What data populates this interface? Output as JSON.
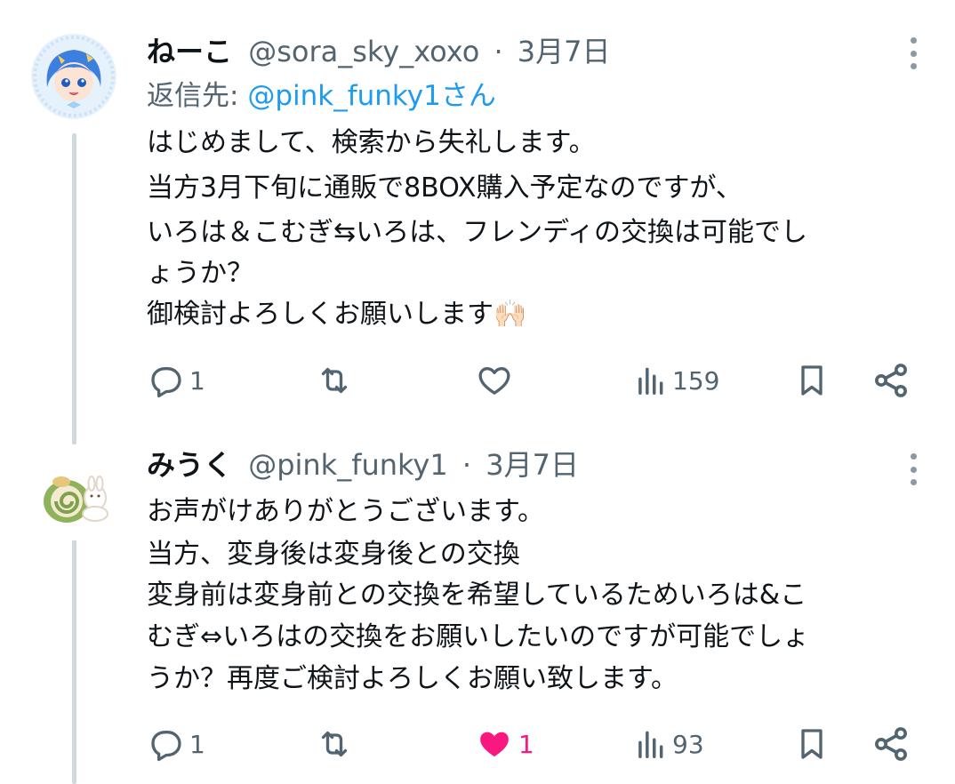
{
  "tweets": [
    {
      "name": "ねーこ",
      "handle": "@sora_sky_xoxo",
      "separator": "·",
      "date": "3月7日",
      "reply_to_prefix": "返信先: ",
      "reply_to_mention": "@pink_funky1さん",
      "lines": [
        "はじめまして、検索から失礼します。",
        "当方3月下旬に通販で8BOX購入予定なのですが、",
        "いろは＆こむぎ⇆いろは、フレンディの交換は可能でし",
        "ょうか？",
        "御検討よろしくお願いします🙌🏻"
      ],
      "actions": {
        "reply_count": "1",
        "retweet_count": "",
        "like_count": "",
        "views_count": "159"
      },
      "liked": false
    },
    {
      "name": "みうく",
      "handle": "@pink_funky1",
      "separator": "·",
      "date": "3月7日",
      "lines": [
        "お声がけありがとうございます。",
        "当方、変身後は変身後との交換",
        "変身前は変身前との交換を希望しているためいろは&こ",
        "むぎ⇔いろはの交換をお願いしたいのですが可能でしょ",
        "うか？再度ご検討よろしくお願い致します。"
      ],
      "actions": {
        "reply_count": "1",
        "retweet_count": "",
        "like_count": "1",
        "views_count": "93"
      },
      "liked": true
    }
  ],
  "colors": {
    "text": "#0f1419",
    "muted": "#536471",
    "link": "#1d9bf0",
    "like": "#f91880",
    "thread_line": "#cfd9de"
  }
}
